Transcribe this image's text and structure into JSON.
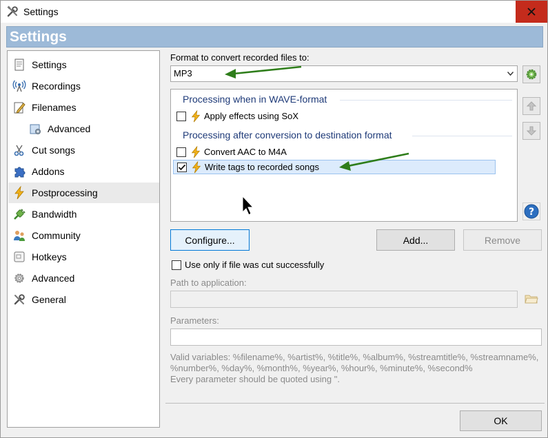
{
  "window": {
    "title": "Settings",
    "header": "Settings",
    "close_glyph": "x"
  },
  "nav": {
    "items": [
      {
        "label": "Settings",
        "icon": "page-icon"
      },
      {
        "label": "Recordings",
        "icon": "broadcast-icon"
      },
      {
        "label": "Filenames",
        "icon": "edit-doc-icon"
      },
      {
        "label": "Advanced",
        "icon": "folder-settings-icon"
      },
      {
        "label": "Cut songs",
        "icon": "scissors-icon"
      },
      {
        "label": "Addons",
        "icon": "puzzle-icon"
      },
      {
        "label": "Postprocessing",
        "icon": "lightning-icon"
      },
      {
        "label": "Bandwidth",
        "icon": "plug-icon"
      },
      {
        "label": "Community",
        "icon": "people-icon"
      },
      {
        "label": "Hotkeys",
        "icon": "key-icon"
      },
      {
        "label": "Advanced",
        "icon": "gear-icon"
      },
      {
        "label": "General",
        "icon": "tools-icon"
      }
    ],
    "selected": "Postprocessing"
  },
  "format": {
    "label": "Format to convert recorded files to:",
    "value": "MP3"
  },
  "processing": {
    "wave_heading": "Processing when in WAVE-format",
    "dest_heading": "Processing after conversion to destination format",
    "items": [
      {
        "label": "Apply effects using SoX",
        "checked": false
      },
      {
        "label": "Convert AAC to M4A",
        "checked": false
      },
      {
        "label": "Write tags to recorded songs",
        "checked": true
      }
    ]
  },
  "buttons": {
    "configure": "Configure...",
    "add": "Add...",
    "remove": "Remove",
    "ok": "OK"
  },
  "options": {
    "cut_only": "Use only if file was cut successfully"
  },
  "fields": {
    "path_label": "Path to application:",
    "path_value": "",
    "params_label": "Parameters:",
    "params_value": ""
  },
  "notes": {
    "variables": "Valid variables: %filename%, %artist%, %title%, %album%, %streamtitle%, %streamname%, %number%, %day%, %month%, %year%, %hour%, %minute%, %second%",
    "quote_hint": "Every parameter should be quoted using \"."
  },
  "colors": {
    "header_band": "#9dbad8",
    "close_button": "#c42b1c",
    "group_heading": "#1e3a78",
    "selection": "#dcebfc",
    "annotation_arrow": "#2e7d1a"
  }
}
